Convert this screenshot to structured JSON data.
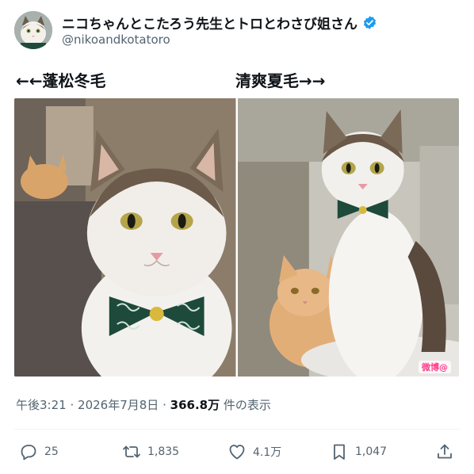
{
  "author": {
    "display_name": "ニコちゃんとこたろう先生とトロとわさび姐さん",
    "handle": "@nikoandkotatoro",
    "avatar_icon": "cat-avatar",
    "verified_icon": "verified-badge-icon",
    "verified_color": "#1d9bf0"
  },
  "post": {
    "caption_left": "←←蓬松冬毛",
    "caption_right": "清爽夏毛→→",
    "images": [
      {
        "name": "cat-winter-coat-photo"
      },
      {
        "name": "cat-summer-coat-photo",
        "watermark": "微博@"
      }
    ],
    "time": "午後3:21",
    "separator": "·",
    "date": "2026年7月8日",
    "views_count": "366.8万",
    "views_label": "件の表示"
  },
  "actions": {
    "reply_count": "25",
    "retweet_count": "1,835",
    "like_count": "4.1万",
    "bookmark_count": "1,047"
  },
  "colors": {
    "text_primary": "#0f1419",
    "text_secondary": "#536471",
    "divider": "#eff3f4",
    "watermark": "#ff3d8b"
  }
}
